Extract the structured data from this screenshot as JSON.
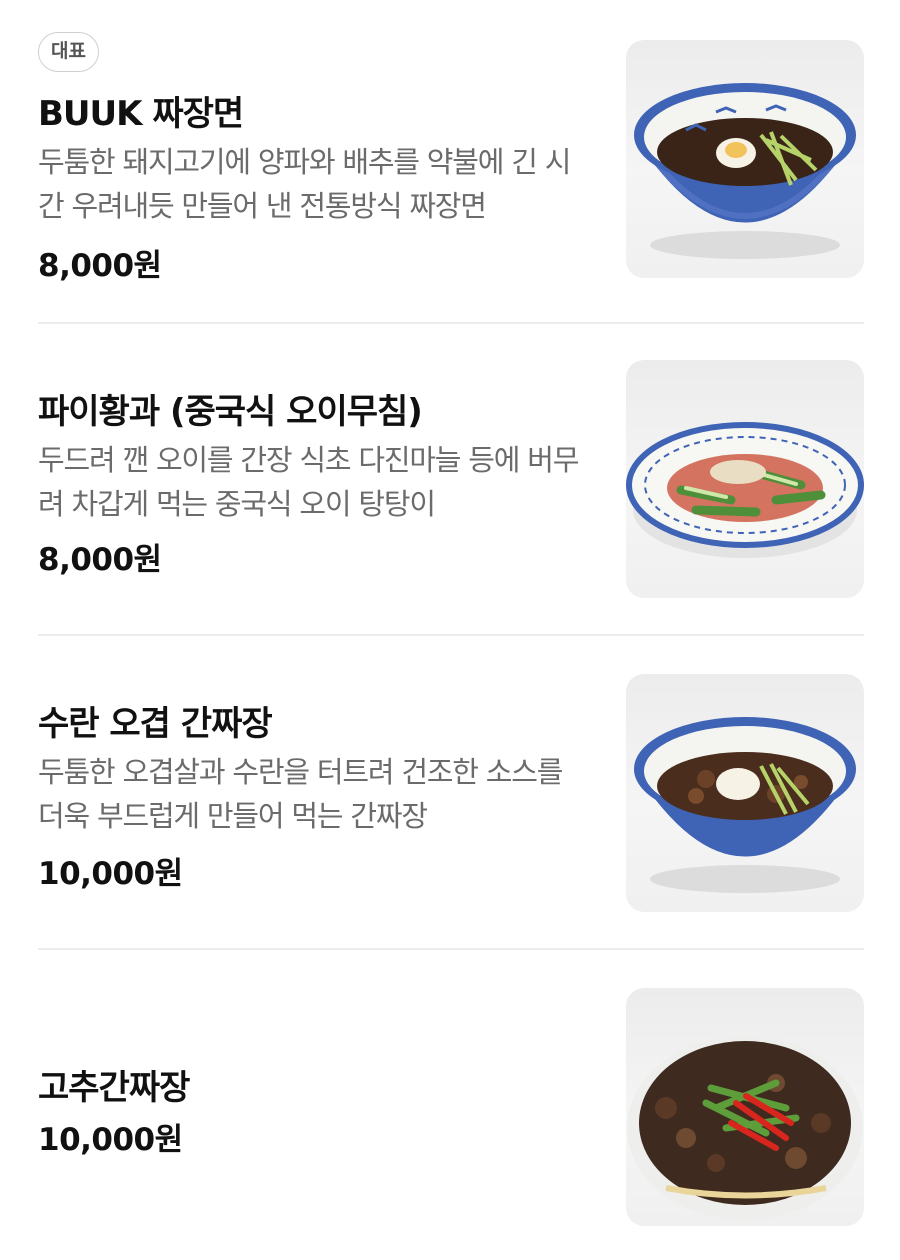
{
  "items": [
    {
      "badge": "대표",
      "name": "BUUK 짜장면",
      "description": "두툼한 돼지고기에 양파와 배추를 약불에 긴 시간 우려내듯 만들어 낸 전통방식 짜장면",
      "price": "8,000원",
      "image_icon": "jjajangmyeon-bowl-image"
    },
    {
      "name": "파이황과 (중국식 오이무침)",
      "description": "두드려 깬 오이를 간장 식초 다진마늘 등에 버무려 차갑게 먹는 중국식 오이 탕탕이",
      "price": "8,000원",
      "image_icon": "cucumber-salad-plate-image"
    },
    {
      "name": "수란 오겹 간짜장",
      "description": "두툼한 오겹살과 수란을 터트려 건조한 소스를 더욱 부드럽게 만들어 먹는 간짜장",
      "price": "10,000원",
      "image_icon": "ganjjajang-bowl-image"
    },
    {
      "name": "고추간짜장",
      "price": "10,000원",
      "image_icon": "chili-ganjjajang-bowl-image"
    }
  ],
  "colors": {
    "text_primary": "#111111",
    "text_secondary": "#6b6b6b",
    "divider": "#ececec",
    "bowl_blue": "#3f63b5"
  }
}
